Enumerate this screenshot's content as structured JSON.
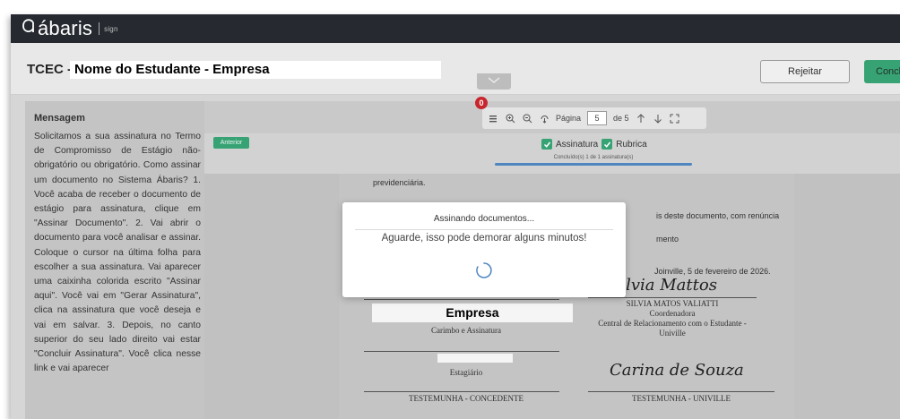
{
  "app": {
    "logo_text": "ábaris",
    "logo_sub": "sign"
  },
  "header": {
    "title_prefix": "TCEC -",
    "student_company": "Nome do Estudante - Empresa",
    "reject_label": "Rejeitar",
    "conclude_label": "Conclu"
  },
  "sidebar": {
    "title": "Mensagem",
    "body": "Solicitamos a sua assinatura no Termo de Compromisso de Estágio não-obrigatório ou obrigatório. Como assinar um documento no Sistema Ábaris? 1. Você acaba de receber o documento de estágio para assinatura, clique em \"Assinar Documento\". 2. Vai abrir o documento para você analisar e assinar. Coloque o cursor na última folha para escolher a sua assinatura. Vai aparecer uma caixinha colorida escrito \"Assinar aqui\". Você vai em \"Gerar Assinatura\", clica na assinatura que você deseja e vai em salvar. 3. Depois, no canto superior do seu lado direito vai estar \"Concluir Assinatura\". Você clica nesse link e vai aparecer"
  },
  "toolbar": {
    "notification_count": "0",
    "page_label": "Página",
    "page_current": "5",
    "page_total": "de 5",
    "icons": [
      "list-icon",
      "zoom-in-icon",
      "zoom-out-icon",
      "rotate-icon",
      "arrow-up-icon",
      "arrow-down-icon",
      "fullscreen-icon"
    ]
  },
  "sign_bar": {
    "prev_label": "Anterior",
    "check_signature": "Assinatura",
    "check_initials": "Rubrica",
    "progress_text": "Concluído(s) 1 de 1 assinatura(s)",
    "progress_fraction": 1.0
  },
  "document": {
    "text_prev": "previdenciária.",
    "text_right1": "is deste documento, com renúncia",
    "text_right2": "mento",
    "date": "Joinville, 5 de fevereiro de 2026.",
    "sig1": "Silvia Mattos",
    "signer1_name": "SILVIA MATOS VALIATTI",
    "signer1_role": "Coordenadora",
    "signer1_org1": "Central de Relacionamento com o Estudante -",
    "signer1_org2": "Univille",
    "company_label": "Empresa",
    "stamp_label": "Carimbo e Assinatura",
    "intern_label": "Estagiário",
    "sig2": "Carina de Souza",
    "witness1": "TESTEMUNHA - CONCEDENTE",
    "witness2": "TESTEMUNHA - UNIVILLE"
  },
  "modal": {
    "title": "Assinando documentos...",
    "message": "Aguarde, isso pode demorar alguns minutos!"
  },
  "colors": {
    "accent_green": "#37a374",
    "badge_red": "#c8262d",
    "topbar": "#262a30",
    "progress_blue": "#4f86bf"
  }
}
